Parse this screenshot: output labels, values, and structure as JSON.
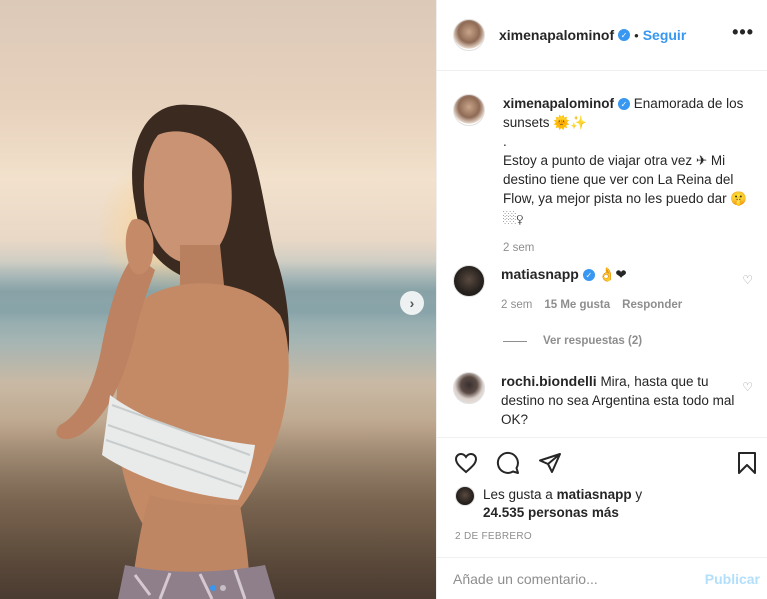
{
  "post": {
    "author": "ximenapalominof",
    "follow_label": "Seguir",
    "more_label": "•••",
    "next_label": "›"
  },
  "caption": {
    "username": "ximenapalominof",
    "first_line": "Enamorada de los sunsets 🌞✨",
    "body": ".\nEstoy a punto de viajar otra vez ✈ Mi destino tiene que ver con La Reina del Flow, ya mejor pista no les puedo dar 🤫🏼‍♀",
    "time": "2 sem"
  },
  "comments": [
    {
      "username": "matiasnapp",
      "text": "👌❤",
      "time": "2 sem",
      "likes": "15 Me gusta",
      "reply_label": "Responder"
    },
    {
      "username": "rochi.biondelli",
      "text": "Mira, hasta que tu destino no sea Argentina esta todo mal OK?"
    }
  ],
  "view_replies": "Ver respuestas (2)",
  "likes": {
    "prefix": "Les gusta a ",
    "user": "matiasnapp",
    "connector": " y ",
    "count": "24.535 personas más"
  },
  "date": "2 DE FEBRERO",
  "add_comment": {
    "placeholder": "Añade un comentario...",
    "publish_label": "Publicar"
  },
  "colors": {
    "accent": "#3897f0",
    "publish_disabled": "#b2dffc",
    "muted": "#8e8e8e"
  },
  "icons": [
    "heart-icon",
    "comment-icon",
    "share-icon",
    "bookmark-icon",
    "verified-badge-icon",
    "more-icon",
    "chevron-right-icon"
  ]
}
